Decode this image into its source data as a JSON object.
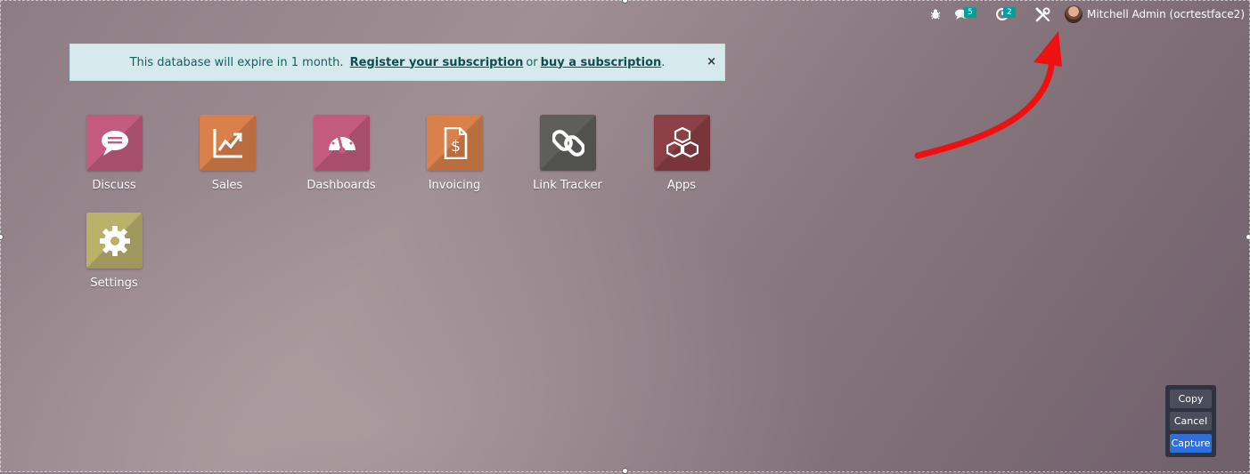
{
  "systray": {
    "debug_icon": "bug-icon",
    "messages_badge": "5",
    "activities_badge": "2",
    "settings_icon": "tools-icon",
    "user_name": "Mitchell Admin (ocrtestface2)"
  },
  "banner": {
    "prefix": "This database will expire in 1 month.",
    "register_link": "Register your subscription",
    "or_text": "or",
    "buy_link": "buy a subscription",
    "suffix": ".",
    "close": "×"
  },
  "apps": [
    {
      "label": "Discuss",
      "icon": "chat-bubble-icon",
      "color": "#c25b7e"
    },
    {
      "label": "Sales",
      "icon": "trend-chart-icon",
      "color": "#d9804b"
    },
    {
      "label": "Dashboards",
      "icon": "gauge-icon",
      "color": "#c25b7e"
    },
    {
      "label": "Invoicing",
      "icon": "invoice-dollar-icon",
      "color": "#d9804b"
    },
    {
      "label": "Link Tracker",
      "icon": "chain-link-icon",
      "color": "#5e5e5c"
    },
    {
      "label": "Apps",
      "icon": "cubes-icon",
      "color": "#8c3f45"
    },
    {
      "label": "Settings",
      "icon": "gear-icon",
      "color": "#b9b06a"
    }
  ],
  "annotation": {
    "arrow_color": "#ee1111"
  },
  "capture_panel": {
    "copy": "Copy",
    "cancel": "Cancel",
    "capture": "Capture"
  }
}
